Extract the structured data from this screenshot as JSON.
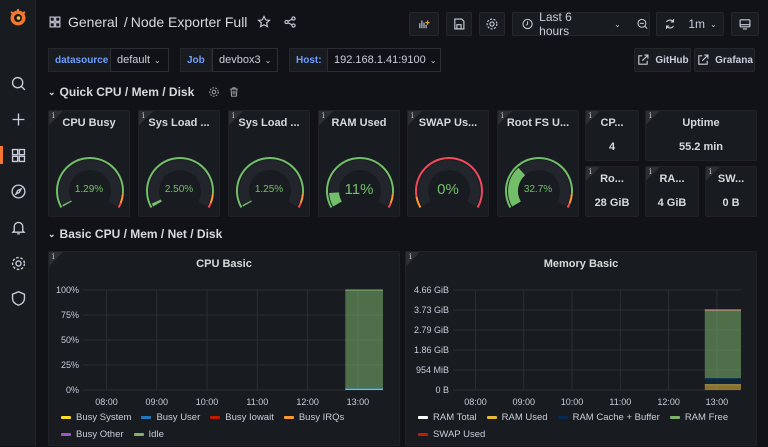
{
  "sidebar": {
    "items": [
      {
        "icon": "grafana-logo"
      },
      {
        "icon": "search-icon"
      },
      {
        "icon": "plus-icon"
      },
      {
        "icon": "dashboards-icon",
        "active": true
      },
      {
        "icon": "compass-icon"
      },
      {
        "icon": "bell-icon"
      },
      {
        "icon": "gear-icon"
      },
      {
        "icon": "shield-icon"
      }
    ]
  },
  "header": {
    "folder": "General",
    "separator": "/",
    "title": "Node Exporter Full",
    "time_range": "Last 6 hours",
    "refresh": "1m"
  },
  "variables": [
    {
      "label": "datasource",
      "value": "default"
    },
    {
      "label": "Job",
      "value": "devbox3"
    },
    {
      "label": "Host:",
      "value": "192.168.1.41:9100"
    }
  ],
  "links": [
    {
      "label": "GitHub"
    },
    {
      "label": "Grafana"
    }
  ],
  "rows": [
    {
      "title": "Quick CPU / Mem / Disk"
    },
    {
      "title": "Basic CPU / Mem / Net / Disk"
    }
  ],
  "gauges": [
    {
      "title": "CPU Busy",
      "value": "1.29%",
      "percent": 1.29,
      "reverse": false
    },
    {
      "title": "Sys Load ...",
      "value": "2.50%",
      "percent": 2.5,
      "reverse": false
    },
    {
      "title": "Sys Load ...",
      "value": "1.25%",
      "percent": 1.25,
      "reverse": false
    },
    {
      "title": "RAM Used",
      "value": "11%",
      "percent": 11,
      "reverse": false
    },
    {
      "title": "SWAP Us...",
      "value": "0%",
      "percent": 0,
      "reverse": true
    },
    {
      "title": "Root FS U...",
      "value": "32.7%",
      "percent": 32.7,
      "reverse": false
    }
  ],
  "stats": [
    {
      "title": "CP...",
      "value": "4"
    },
    {
      "title": "Uptime",
      "value": "55.2 min"
    },
    {
      "title": "Ro...",
      "value": "28 GiB"
    },
    {
      "title": "RA...",
      "value": "4 GiB"
    },
    {
      "title": "SW...",
      "value": "0 B"
    }
  ],
  "colors": {
    "green": "#73bf69",
    "orange": "#ff9830",
    "red": "#f2495c",
    "accent": "#f5772f"
  },
  "chart_data": [
    {
      "type": "area",
      "title": "CPU Basic",
      "x_ticks": [
        "08:00",
        "09:00",
        "10:00",
        "11:00",
        "12:00",
        "13:00"
      ],
      "y_ticks": [
        "100%",
        "75%",
        "50%",
        "25%",
        "0%"
      ],
      "ylim": [
        0,
        100
      ],
      "xlim": [
        "07:32",
        "13:30"
      ],
      "grid": true,
      "legend": "bottom",
      "series": [
        {
          "name": "Busy System",
          "color": "#fade2a",
          "x": [
            "12:45",
            "13:30"
          ],
          "values": [
            0.5,
            0.5
          ]
        },
        {
          "name": "Busy User",
          "color": "#1f78c1",
          "x": [
            "12:45",
            "13:30"
          ],
          "values": [
            0.8,
            0.8
          ]
        },
        {
          "name": "Busy Iowait",
          "color": "#bf1b00",
          "x": [
            "12:45",
            "13:30"
          ],
          "values": [
            0,
            0
          ]
        },
        {
          "name": "Busy IRQs",
          "color": "#ff9830",
          "x": [
            "12:45",
            "13:30"
          ],
          "values": [
            0,
            0
          ]
        },
        {
          "name": "Busy Other",
          "color": "#a352cc",
          "x": [
            "12:45",
            "13:30"
          ],
          "values": [
            0,
            0
          ]
        },
        {
          "name": "Idle",
          "color": "#7eb26d",
          "x": [
            "12:45",
            "13:30"
          ],
          "values": [
            98.7,
            98.7
          ]
        }
      ]
    },
    {
      "type": "area",
      "title": "Memory Basic",
      "x_ticks": [
        "08:00",
        "09:00",
        "10:00",
        "11:00",
        "12:00",
        "13:00"
      ],
      "y_ticks": [
        "4.66 GiB",
        "3.73 GiB",
        "2.79 GiB",
        "1.86 GiB",
        "954 MiB",
        "0 B"
      ],
      "ylim": [
        0,
        4.66
      ],
      "xlim": [
        "07:32",
        "13:30"
      ],
      "grid": true,
      "legend": "bottom",
      "series": [
        {
          "name": "RAM Total",
          "color": "#ffffff",
          "x": [
            "12:45",
            "13:30"
          ],
          "values": [
            3.73,
            3.73
          ]
        },
        {
          "name": "RAM Used",
          "color": "#eab839",
          "x": [
            "12:45",
            "13:30"
          ],
          "values": [
            0.25,
            0.25
          ]
        },
        {
          "name": "RAM Cache + Buffer",
          "color": "#052b51",
          "x": [
            "12:45",
            "13:30"
          ],
          "values": [
            0.3,
            0.3
          ]
        },
        {
          "name": "RAM Free",
          "color": "#7eb26d",
          "x": [
            "12:45",
            "13:30"
          ],
          "values": [
            3.18,
            3.18
          ]
        },
        {
          "name": "SWAP Used",
          "color": "#bf1b00",
          "x": [
            "12:45",
            "13:30"
          ],
          "values": [
            0,
            0
          ]
        }
      ]
    }
  ]
}
